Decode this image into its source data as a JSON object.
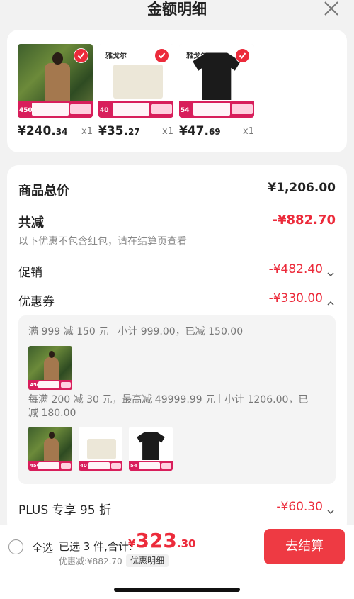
{
  "header": {
    "title": "金额明细"
  },
  "products": [
    {
      "price_int": "¥240.",
      "price_dec": "34",
      "qty": "x1",
      "tag_num": "450",
      "image": "man-in-coat"
    },
    {
      "price_int": "¥35.",
      "price_dec": "27",
      "qty": "x1",
      "tag_num": "40",
      "image": "cream-cloth",
      "brand": "雅戈尔"
    },
    {
      "price_int": "¥47.",
      "price_dec": "69",
      "qty": "x1",
      "tag_num": "54",
      "image": "black-tshirt",
      "brand": "雅戈尔"
    }
  ],
  "summary": {
    "total_label": "商品总价",
    "total_value": "¥1,206.00",
    "reduce_label": "共减",
    "reduce_value": "-¥882.70",
    "note": "以下优惠不包含红包，请在结算页查看",
    "promo_label": "促销",
    "promo_value": "-¥482.40",
    "coupon_label": "优惠券",
    "coupon_value": "-¥330.00",
    "plus_label": "PLUS 专享 95 折",
    "plus_value": "-¥60.30"
  },
  "coupons": {
    "c1_main": "满 999 减 150 元",
    "c1_sub": "小计 999.00，已减 150.00",
    "c2_main": "每满 200 减 30 元，最高减 49999.99 元",
    "c2_sub_a": "小计 1206.00，已",
    "c2_sub_b": "减 180.00"
  },
  "bottom": {
    "select_all": "全选",
    "selected": "已选 3 件,合计:",
    "cur": "¥",
    "total_int": "323",
    "total_dec": ".30",
    "discount": "优惠减:¥882.70",
    "detail_button": "优惠明细",
    "checkout": "去结算"
  },
  "colors": {
    "accent": "#ec2b3b",
    "checkout": "#ee3a43",
    "tag": "#d81e5b"
  }
}
